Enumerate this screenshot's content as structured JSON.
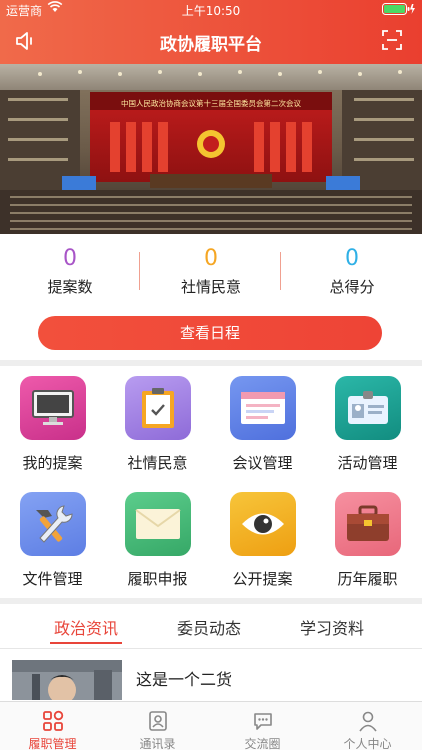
{
  "status_bar": {
    "carrier": "运营商",
    "time": "上午10:50"
  },
  "nav": {
    "title": "政协履职平台",
    "left_icon": "speaker-icon",
    "right_icon": "scan-icon"
  },
  "banner": {
    "caption": "中国人民政治协商会议第十三届全国委员会第二次会议"
  },
  "stats": [
    {
      "value": "0",
      "label": "提案数"
    },
    {
      "value": "0",
      "label": "社情民意"
    },
    {
      "value": "0",
      "label": "总得分"
    }
  ],
  "schedule_button": "查看日程",
  "grid": [
    {
      "label": "我的提案",
      "icon": "monitor-icon",
      "color": "#d9489a"
    },
    {
      "label": "社情民意",
      "icon": "clipboard-icon",
      "color": "#9d7fe0"
    },
    {
      "label": "会议管理",
      "icon": "browser-window-icon",
      "color": "#5d7ee8"
    },
    {
      "label": "活动管理",
      "icon": "id-card-icon",
      "color": "#1fa597"
    },
    {
      "label": "文件管理",
      "icon": "tools-icon",
      "color": "#6e8ee8"
    },
    {
      "label": "履职申报",
      "icon": "envelope-icon",
      "color": "#48c07c"
    },
    {
      "label": "公开提案",
      "icon": "eye-icon",
      "color": "#f2b21e"
    },
    {
      "label": "历年履职",
      "icon": "briefcase-icon",
      "color": "#f07a8c"
    }
  ],
  "tabs": [
    {
      "label": "政治资讯",
      "active": true
    },
    {
      "label": "委员动态",
      "active": false
    },
    {
      "label": "学习资料",
      "active": false
    }
  ],
  "news": [
    {
      "title": "这是一个二货"
    }
  ],
  "tabbar": [
    {
      "label": "履职管理",
      "icon": "grid-icon",
      "active": true
    },
    {
      "label": "通讯录",
      "icon": "contacts-icon",
      "active": false
    },
    {
      "label": "交流圈",
      "icon": "chat-icon",
      "active": false
    },
    {
      "label": "个人中心",
      "icon": "person-icon",
      "active": false
    }
  ],
  "colors": {
    "accent": "#e8453a",
    "stat_number": "#a855c7",
    "stat_number_2": "#f5a623",
    "stat_number_3": "#2fb0e6"
  }
}
